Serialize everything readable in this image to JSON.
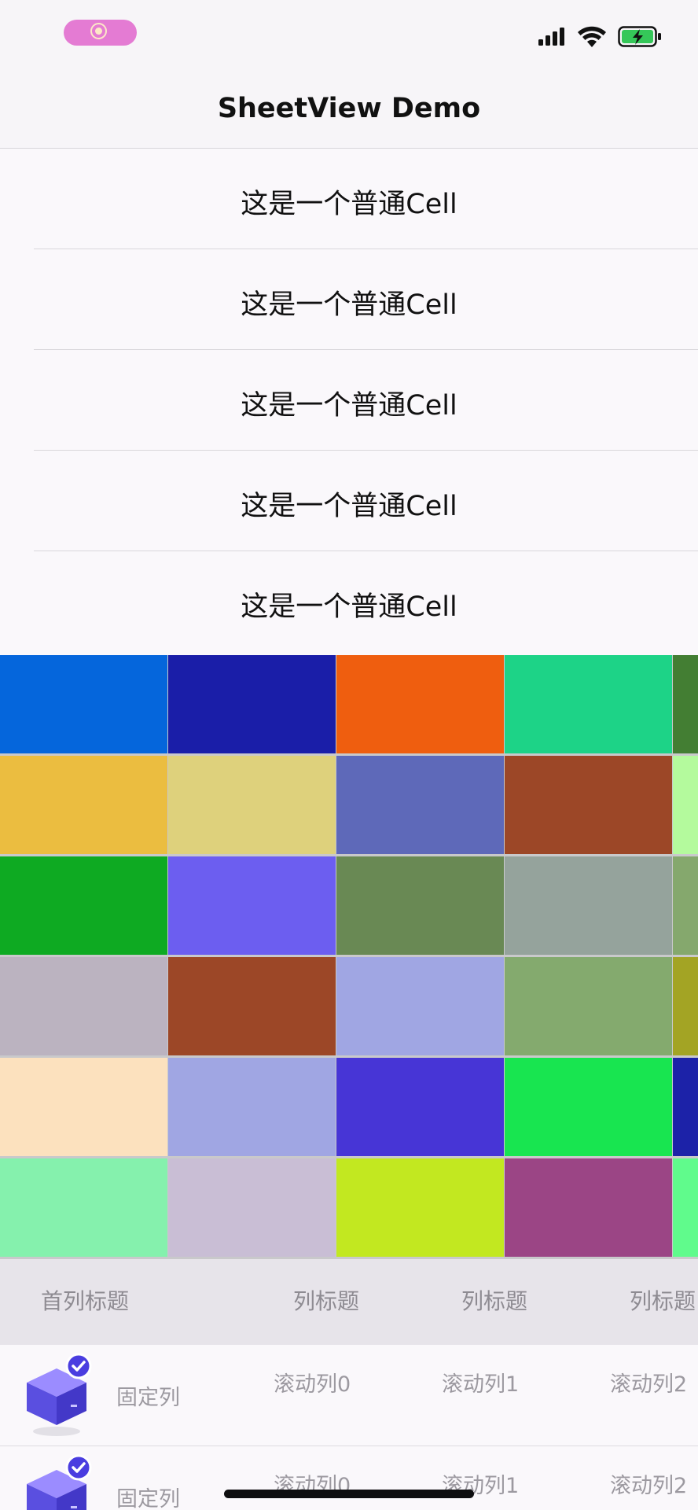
{
  "status_bar": {
    "icons": [
      "screen-record-icon",
      "signal-icon",
      "wifi-icon",
      "battery-charging-icon"
    ],
    "record_color": "#e47bd3",
    "battery_color": "#35c759"
  },
  "nav": {
    "title": "SheetView Demo"
  },
  "plain_cells": [
    {
      "label": "这是一个普通Cell"
    },
    {
      "label": "这是一个普通Cell"
    },
    {
      "label": "这是一个普通Cell"
    },
    {
      "label": "这是一个普通Cell"
    },
    {
      "label": "这是一个普通Cell"
    }
  ],
  "color_grid": {
    "rows": [
      [
        "#0566dc",
        "#1a1ea8",
        "#ef5e0f",
        "#1dd387",
        "#437e33"
      ],
      [
        "#ebbd40",
        "#ded17c",
        "#5e69b9",
        "#9c4727",
        "#b4fa9d"
      ],
      [
        "#0eaa22",
        "#6c5ef0",
        "#698954",
        "#95a39c",
        "#85a86d"
      ],
      [
        "#bbb3c0",
        "#9c4727",
        "#a0a6e3",
        "#84aa6e",
        "#a3a424"
      ],
      [
        "#fce1be",
        "#a0a6e3",
        "#4735d6",
        "#18e550",
        "#1c22a8"
      ],
      [
        "#85f1ad",
        "#c9bed5",
        "#c2e820",
        "#9b4585",
        "#60fb8c"
      ]
    ]
  },
  "sheet": {
    "header": {
      "first_column_title": "首列标题",
      "column_titles": [
        "列标题",
        "列标题",
        "列标题"
      ]
    },
    "rows": [
      {
        "icon": "cube-check-icon",
        "fixed": "固定列",
        "scroll": [
          "滚动列0",
          "滚动列1",
          "滚动列2"
        ]
      },
      {
        "icon": "cube-check-icon",
        "fixed": "固定列",
        "scroll": [
          "滚动列0",
          "滚动列1",
          "滚动列2"
        ]
      }
    ]
  }
}
